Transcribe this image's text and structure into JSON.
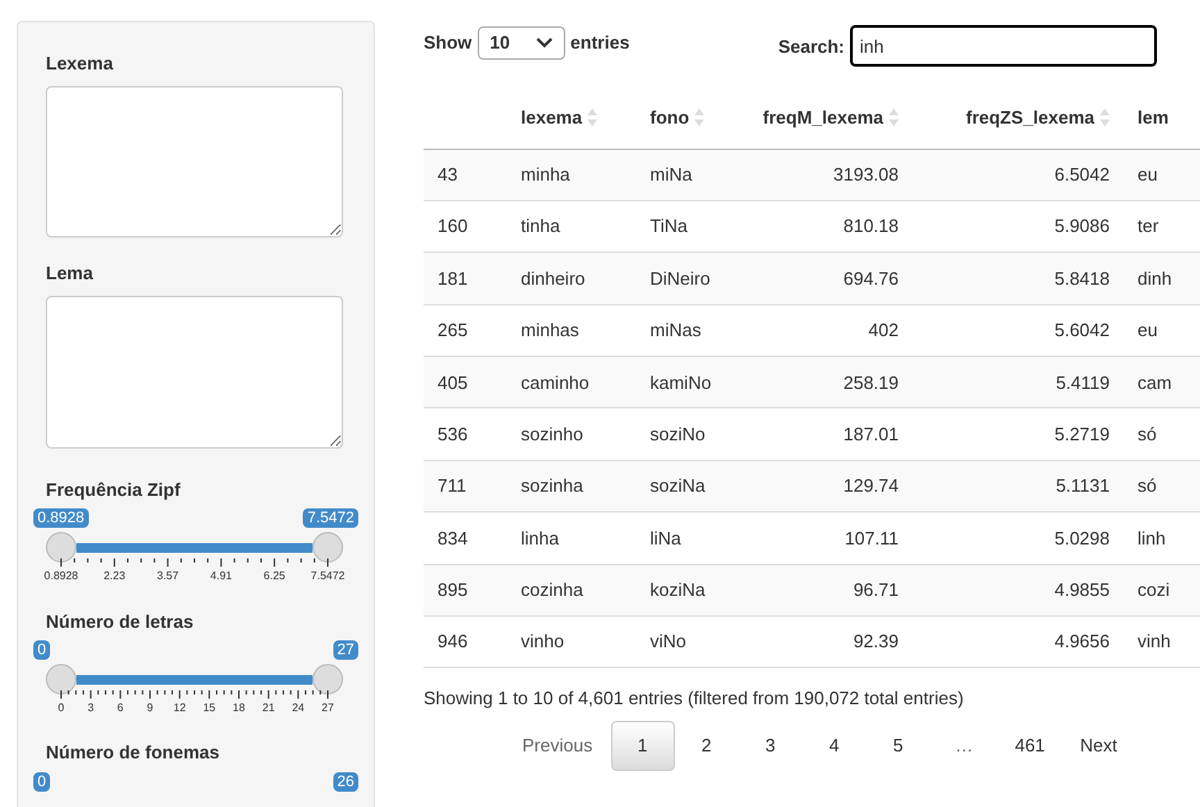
{
  "sidebar": {
    "text_fields": [
      {
        "label": "Lexema"
      },
      {
        "label": "Lema"
      }
    ],
    "sliders": [
      {
        "label": "Frequência Zipf",
        "min_value": "0.8928",
        "max_value": "7.5472",
        "level": 1,
        "ticks": [
          "0.8928",
          "2.23",
          "3.57",
          "4.91",
          "6.25",
          "7.5472"
        ]
      },
      {
        "label": "Número de letras",
        "min_value": "0",
        "max_value": "27",
        "level": 1,
        "ticks": [
          "0",
          "3",
          "6",
          "9",
          "12",
          "15",
          "18",
          "21",
          "24",
          "27"
        ]
      },
      {
        "label": "Número de fonemas",
        "min_value": "0",
        "max_value": "26"
      }
    ]
  },
  "table_controls": {
    "show_label": "Show",
    "page_size": "10",
    "entries_label": "entries",
    "search_label": "Search:",
    "search_value": "inh"
  },
  "table": {
    "columns": [
      "",
      "lexema",
      "fono",
      "freqM_lexema",
      "freqZS_lexema",
      "lem"
    ],
    "rows": [
      [
        "43",
        "minha",
        "miNa",
        "3193.08",
        "6.5042",
        "eu"
      ],
      [
        "160",
        "tinha",
        "TiNa",
        "810.18",
        "5.9086",
        "ter"
      ],
      [
        "181",
        "dinheiro",
        "DiNeiro",
        "694.76",
        "5.8418",
        "dinh"
      ],
      [
        "265",
        "minhas",
        "miNas",
        "402",
        "5.6042",
        "eu"
      ],
      [
        "405",
        "caminho",
        "kamiNo",
        "258.19",
        "5.4119",
        "cam"
      ],
      [
        "536",
        "sozinho",
        "soziNo",
        "187.01",
        "5.2719",
        "só"
      ],
      [
        "711",
        "sozinha",
        "soziNa",
        "129.74",
        "5.1131",
        "só"
      ],
      [
        "834",
        "linha",
        "liNa",
        "107.11",
        "5.0298",
        "linh"
      ],
      [
        "895",
        "cozinha",
        "koziNa",
        "96.71",
        "4.9855",
        "cozi"
      ],
      [
        "946",
        "vinho",
        "viNo",
        "92.39",
        "4.9656",
        "vinh"
      ]
    ]
  },
  "info": "Showing 1 to 10 of 4,601 entries (filtered from 190,072 total entries)",
  "pagination": [
    {
      "label": "Previous",
      "kind": "nav",
      "selected": false
    },
    {
      "label": "1",
      "kind": "page",
      "selected": true
    },
    {
      "label": "2",
      "kind": "page",
      "selected": false
    },
    {
      "label": "3",
      "kind": "page",
      "selected": false
    },
    {
      "label": "4",
      "kind": "page",
      "selected": false
    },
    {
      "label": "5",
      "kind": "page",
      "selected": false
    },
    {
      "label": "…",
      "kind": "gap",
      "selected": false
    },
    {
      "label": "461",
      "kind": "page",
      "selected": false
    },
    {
      "label": "Next",
      "kind": "nav",
      "selected": false
    }
  ]
}
